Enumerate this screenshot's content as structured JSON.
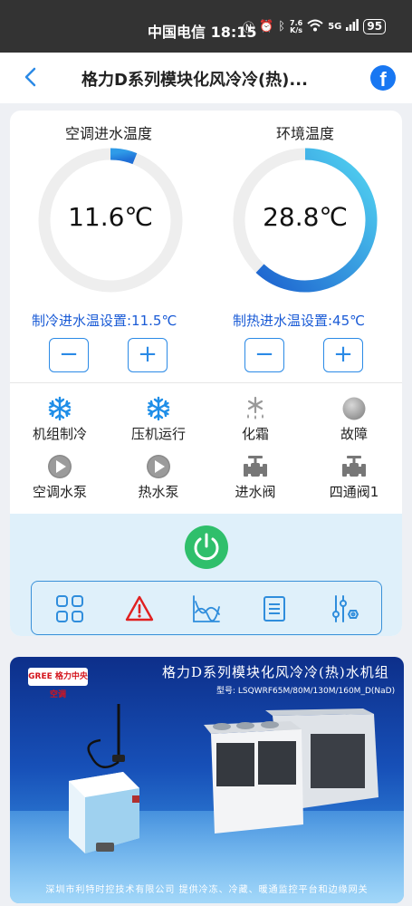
{
  "statusbar": {
    "carrier_time": "中国电信 18:15",
    "netspeed_top": "7.6",
    "netspeed_bottom": "K/s",
    "network": "5G",
    "battery": "95"
  },
  "header": {
    "title": "格力D系列模块化风冷冷(热)...",
    "back_icon": "chevron-left-icon",
    "share_icon": "facebook-icon"
  },
  "gauges": {
    "inlet": {
      "title": "空调进水温度",
      "value": "11.6℃",
      "fill_fraction": 0.06,
      "setpoint_label": "制冷进水温设置:11.5℃"
    },
    "ambient": {
      "title": "环境温度",
      "value": "28.8℃",
      "fill_fraction": 0.62,
      "setpoint_label": "制热进水温设置:45℃"
    },
    "minus": "−",
    "plus": "+"
  },
  "status": [
    {
      "label": "机组制冷",
      "icon": "snowflake-icon"
    },
    {
      "label": "压机运行",
      "icon": "snowflake-icon"
    },
    {
      "label": "化霜",
      "icon": "defrost-icon"
    },
    {
      "label": "故障",
      "icon": "fault-indicator-icon"
    },
    {
      "label": "空调水泵",
      "icon": "pump-icon"
    },
    {
      "label": "热水泵",
      "icon": "pump-icon"
    },
    {
      "label": "进水阀",
      "icon": "valve-icon"
    },
    {
      "label": "四通阀1",
      "icon": "valve-icon"
    }
  ],
  "toolbar": [
    "grid-icon",
    "alarm-icon",
    "curve-icon",
    "list-icon",
    "settings-icon"
  ],
  "colors": {
    "accent_blue": "#2b8ae6",
    "setpoint_blue": "#1a5bd6",
    "power_green": "#2fbf6b",
    "alarm_red": "#e02020"
  },
  "banner": {
    "logo": "GREE 格力中央空调",
    "title": "格力D系列模块化风冷冷(热)水机组",
    "model": "型号: LSQWRF65M/80M/130M/160M_D(NaD)",
    "footer": "深圳市利特时控技术有限公司   提供冷冻、冷藏、暖通监控平台和边缘网关"
  }
}
